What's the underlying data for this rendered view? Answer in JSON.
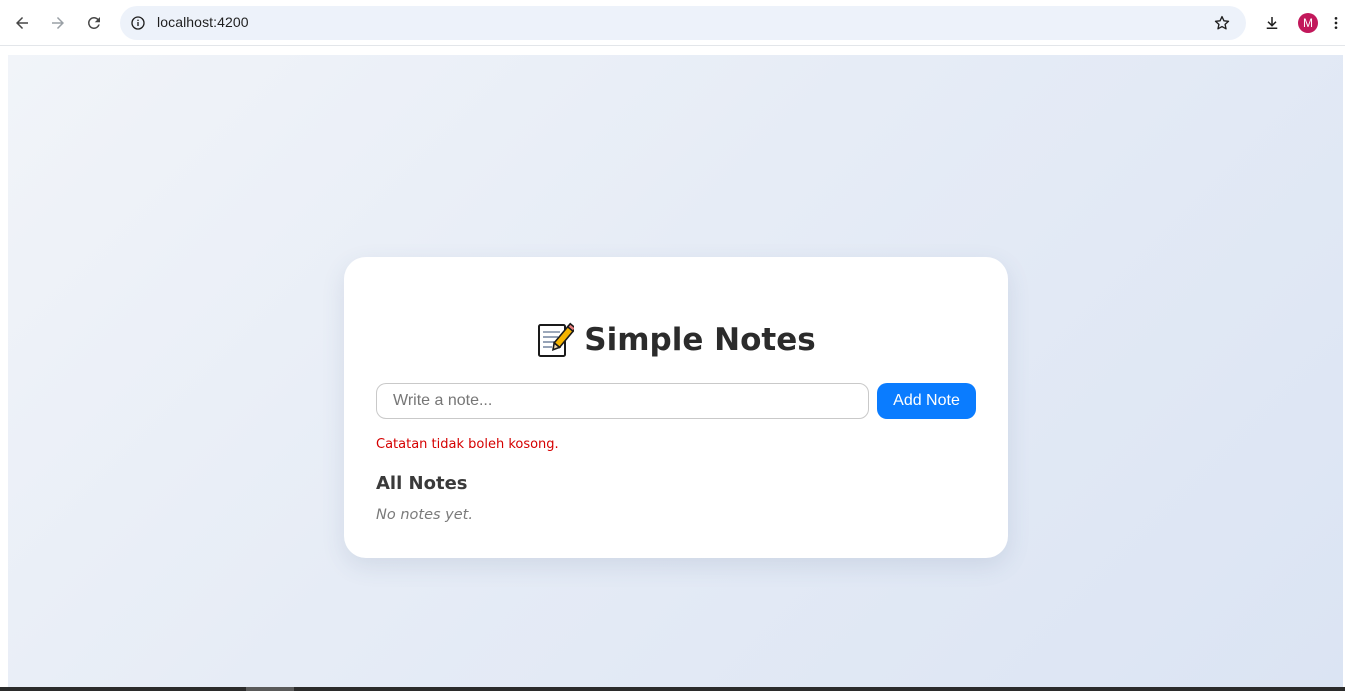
{
  "browser": {
    "url": "localhost:4200",
    "profile_initial": "M",
    "profile_color": "#c2185b",
    "icons": {
      "back": "arrow-left-icon",
      "forward": "arrow-right-icon",
      "reload": "reload-icon",
      "site_info": "info-icon",
      "bookmark": "star-icon",
      "download": "download-icon",
      "menu": "kebab-menu-icon"
    }
  },
  "app": {
    "title": "Simple Notes",
    "title_icon": "memo-icon",
    "input": {
      "placeholder": "Write a note...",
      "value": ""
    },
    "add_button_label": "Add Note",
    "error_message": "Catatan tidak boleh kosong.",
    "notes_heading": "All Notes",
    "empty_message": "No notes yet.",
    "notes": []
  },
  "colors": {
    "accent": "#0a7cff",
    "error": "#d50000"
  }
}
